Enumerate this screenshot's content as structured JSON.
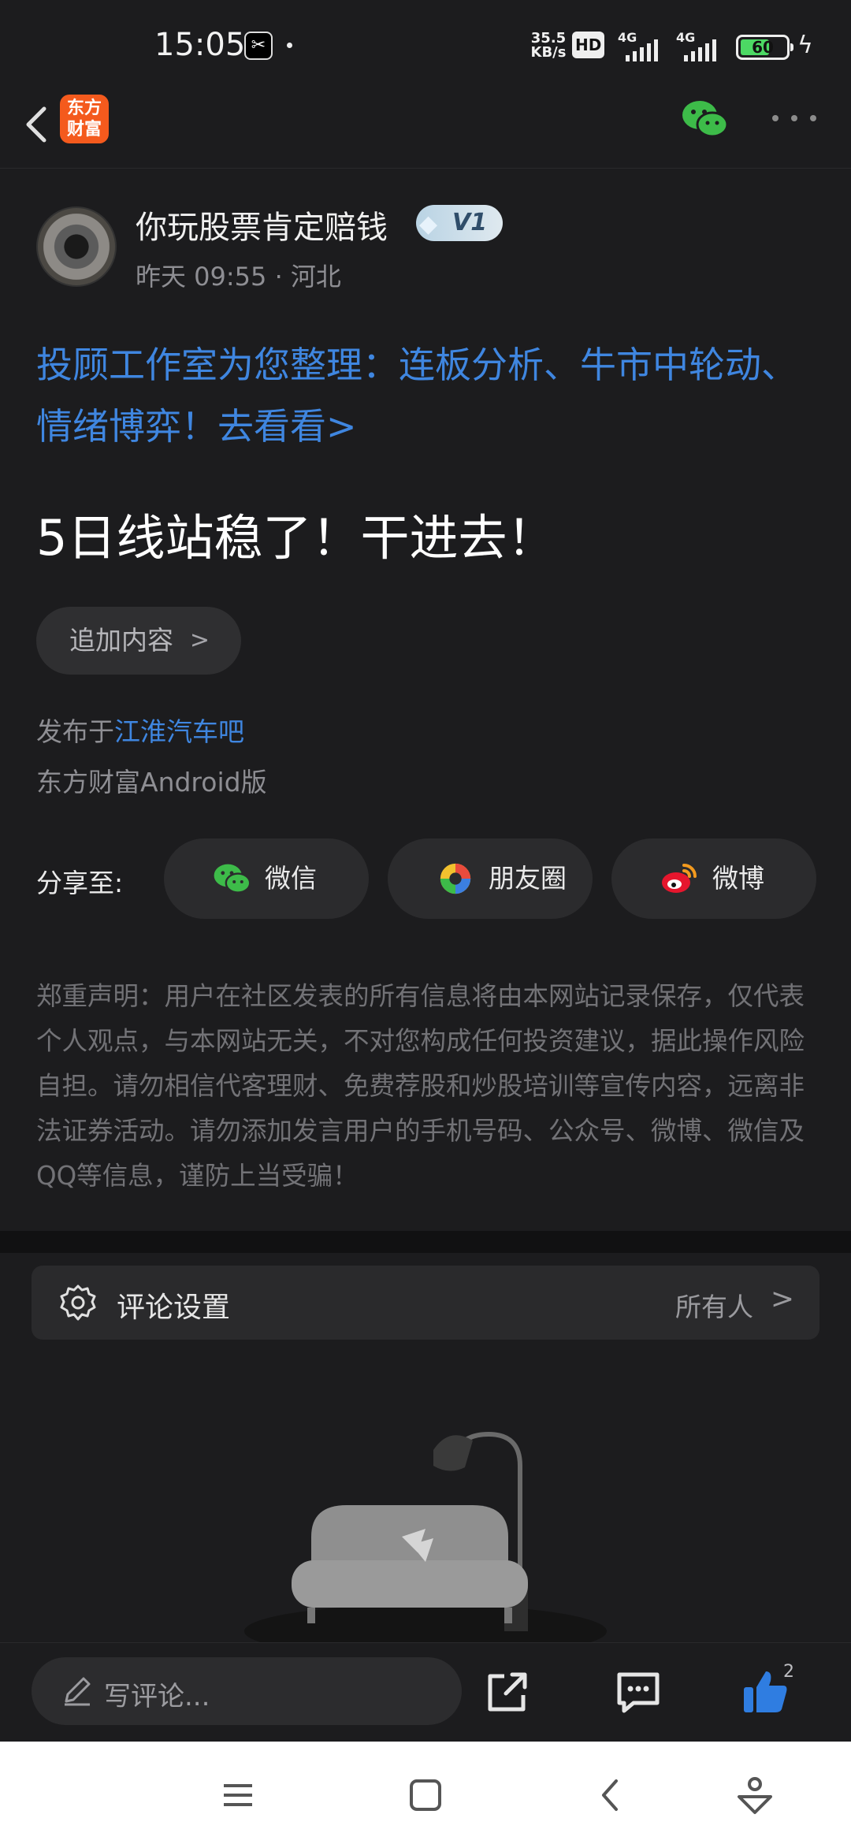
{
  "status_bar": {
    "time": "15:05",
    "app_icon": "capcut-icon",
    "net_speed_value": "35.5",
    "net_speed_unit": "KB/s",
    "hd_label": "HD",
    "signal1_label": "4G",
    "signal2_label": "4G",
    "battery": "60"
  },
  "nav": {
    "logo_line1": "东方",
    "logo_line2": "财富",
    "icons": [
      "back-arrow-icon",
      "wechat-icon",
      "more-icon"
    ]
  },
  "post": {
    "author": "你玩股票肯定赔钱",
    "level_badge": "V1",
    "time": "昨天 09:55",
    "location": "河北",
    "promo_link": "投顾工作室为您整理：连板分析、牛市中轮动、情绪博弈！去看看>",
    "title": "5日线站稳了！干进去！",
    "add_content_label": "追加内容",
    "published_prefix": "发布于",
    "bar_name": "江淮汽车吧",
    "client": "东方财富Android版"
  },
  "share": {
    "label": "分享至:",
    "buttons": [
      {
        "label": "微信",
        "icon": "wechat-icon"
      },
      {
        "label": "朋友圈",
        "icon": "moments-icon"
      },
      {
        "label": "微博",
        "icon": "weibo-icon"
      }
    ]
  },
  "disclaimer": "郑重声明：用户在社区发表的所有信息将由本网站记录保存，仅代表个人观点，与本网站无关，不对您构成任何投资建议，据此操作风险自担。请勿相信代客理财、免费荐股和炒股培训等宣传内容，远离非法证券活动。请勿添加发言用户的手机号码、公众号、微博、微信及QQ等信息，谨防上当受骗！",
  "comment_settings": {
    "label": "评论设置",
    "value": "所有人"
  },
  "bottom_bar": {
    "placeholder": "写评论...",
    "like_count": "2"
  },
  "colors": {
    "background": "#1c1c1e",
    "link_blue": "#3f86e0",
    "brand_orange": "#f45a1d",
    "wechat_green": "#3dbb49"
  }
}
